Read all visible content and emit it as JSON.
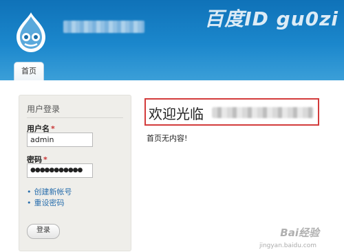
{
  "watermark_top": "百度ID gu0zi",
  "tabs": [
    {
      "label": "首页"
    }
  ],
  "login": {
    "title": "用户登录",
    "username_label": "用户名",
    "username_value": "admin",
    "password_label": "密码",
    "password_value": "●●●●●●●●●●●",
    "required_mark": "*",
    "links": [
      {
        "label": "创建新帐号"
      },
      {
        "label": "重设密码"
      }
    ],
    "submit_label": "登录"
  },
  "main": {
    "welcome": "欢迎光临",
    "empty_message": "首页无内容!"
  },
  "watermark_bottom": {
    "brand": "Bai经验",
    "url": "jingyan.baidu.com"
  },
  "colors": {
    "header_blue": "#1b87cc",
    "link_blue": "#2a6fad",
    "highlight_red": "#d33a3a",
    "required_red": "#c83232"
  }
}
